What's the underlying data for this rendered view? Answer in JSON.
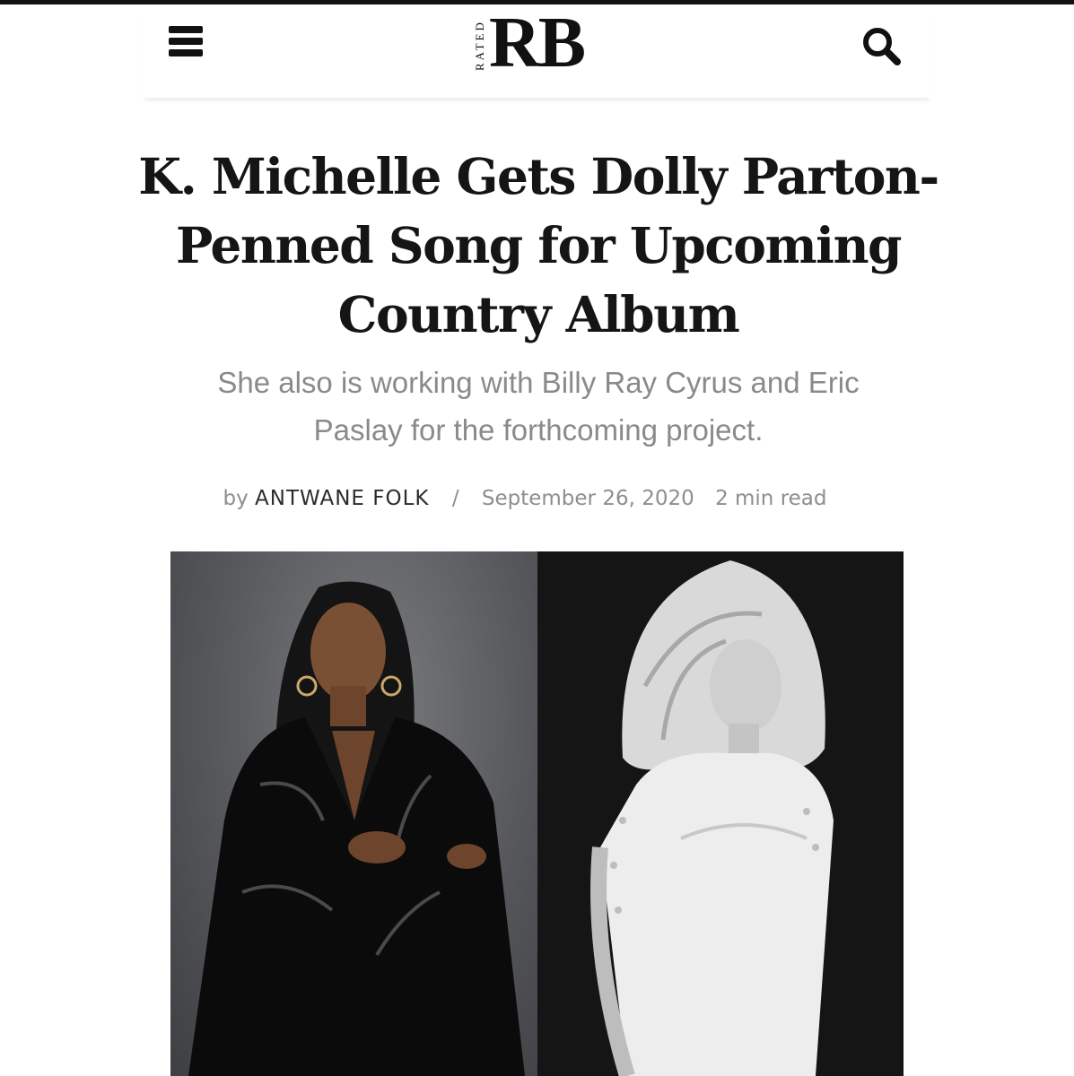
{
  "header": {
    "menu_icon": "hamburger-menu-icon",
    "logo_small": "RATED",
    "logo_main": "RB",
    "search_icon": "search-icon"
  },
  "article": {
    "headline": "K. Michelle Gets Dolly Parton-Penned Song for Upcoming Country Album",
    "dek": "She also is working with Billy Ray Cyrus and Eric Paslay for the forthcoming project.",
    "byline_prefix": "by",
    "author": "ANTWANE FOLK",
    "separator": "/",
    "date": "September 26, 2020",
    "read_time": "2 min read"
  },
  "colors": {
    "text": "#151515",
    "muted": "#8a8a8a",
    "left_backdrop": "#57585b",
    "right_backdrop": "#151515"
  }
}
